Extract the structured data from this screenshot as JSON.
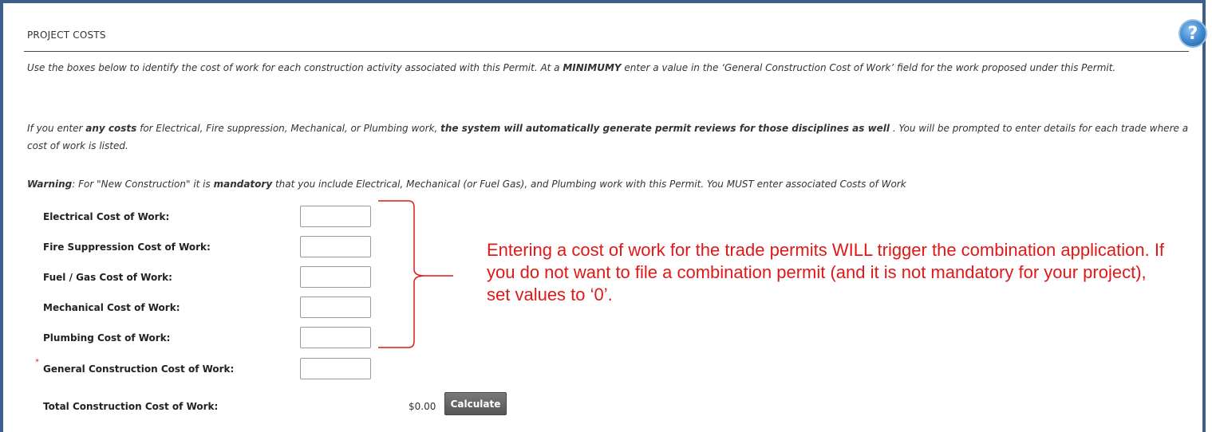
{
  "section": {
    "title": "PROJECT COSTS",
    "help_icon": "help-circle-icon"
  },
  "instructions": {
    "p1_a": "Use the boxes below to identify the cost of work for each construction activity associated with this Permit. At a ",
    "p1_b": "MINIMUMY",
    "p1_c": " enter a value in the ‘General Construction Cost of Work’ field for the work proposed under this Permit.",
    "p2_a": "If you enter ",
    "p2_b": "any costs",
    "p2_c": " for Electrical, Fire suppression, Mechanical, or Plumbing work, ",
    "p2_d": "the system will automatically generate permit reviews for those disciplines as well",
    "p2_e": " . You will be prompted to enter details for each trade where a cost of work is listed.",
    "p3_a": "Warning",
    "p3_b": ": For \"New Construction\" it is ",
    "p3_c": "mandatory",
    "p3_d": " that you include Electrical, Mechanical (or Fuel Gas), and Plumbing work with this Permit. You MUST enter associated Costs of Work"
  },
  "fields": {
    "electrical": {
      "label": "Electrical Cost of Work:",
      "value": ""
    },
    "fire": {
      "label": "Fire Suppression Cost of Work:",
      "value": ""
    },
    "fuel": {
      "label": "Fuel / Gas Cost of Work:",
      "value": ""
    },
    "mechanical": {
      "label": "Mechanical Cost of Work:",
      "value": ""
    },
    "plumbing": {
      "label": "Plumbing Cost of Work:",
      "value": ""
    },
    "general": {
      "label": "General Construction Cost of Work:",
      "value": "",
      "required_mark": "*"
    }
  },
  "total": {
    "label": "Total Construction Cost of Work:",
    "value": "$0.00",
    "button_label": "Calculate"
  },
  "annotation": {
    "text": "Entering a cost of work for the trade permits WILL trigger the combination application. If you do not want to file a combination permit (and it is not mandatory for your project), set values to ‘0’.",
    "color": "#e01818"
  },
  "colors": {
    "frame": "#3d5f8a",
    "required": "#d22222"
  }
}
